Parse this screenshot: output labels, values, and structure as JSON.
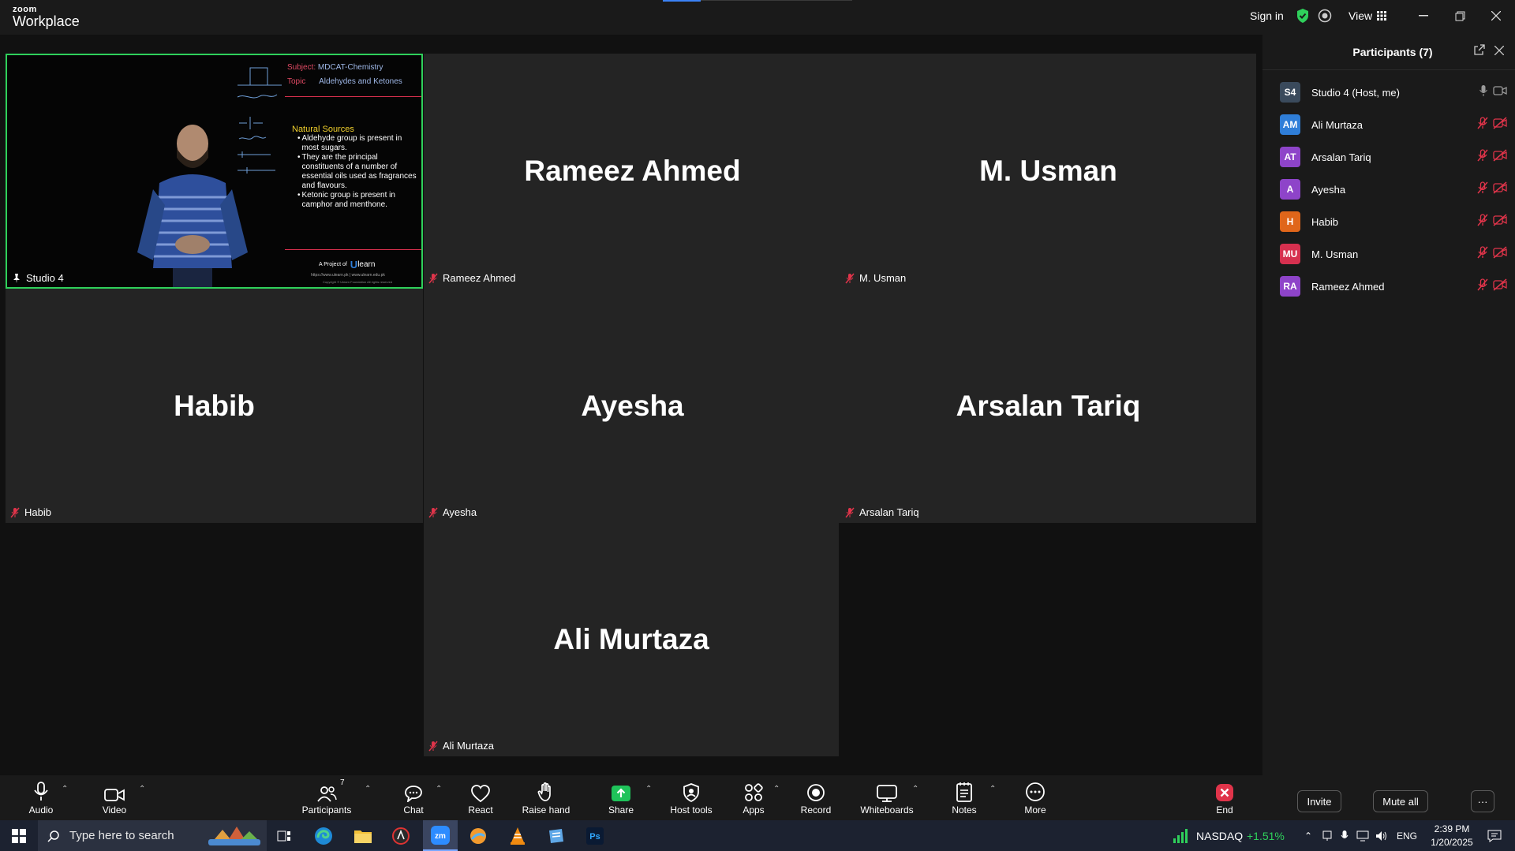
{
  "titlebar": {
    "logo_top": "zoom",
    "logo_bottom": "Workplace",
    "sign_in": "Sign in",
    "view": "View"
  },
  "tiles": [
    {
      "big": "",
      "tag": "Studio 4"
    },
    {
      "big": "Rameez Ahmed",
      "tag": "Rameez Ahmed"
    },
    {
      "big": "M. Usman",
      "tag": "M. Usman"
    },
    {
      "big": "Habib",
      "tag": "Habib"
    },
    {
      "big": "Ayesha",
      "tag": "Ayesha"
    },
    {
      "big": "Arsalan Tariq",
      "tag": "Arsalan Tariq"
    },
    {
      "big": "Ali Murtaza",
      "tag": "Ali Murtaza"
    }
  ],
  "slide": {
    "subject_label": "Subject:",
    "subject_value": "MDCAT-Chemistry",
    "topic_label": "Topic",
    "topic_value": "Aldehydes and Ketones",
    "heading": "Natural Sources",
    "bullets": [
      "Aldehyde group is present in most sugars.",
      "They are the principal constituents of a number of essential oils used as fragrances and flavours.",
      "Ketonic group is present in camphor and menthone."
    ],
    "footer_project": "A Project of",
    "footer_brand": "learn",
    "footer_line1": "https://www.ulearn.pk | www.ulearn.edu.pk",
    "footer_line2": "Copyright © Ulearn Foundation All rights reserved"
  },
  "participants": {
    "title": "Participants (7)",
    "list": [
      {
        "initials": "S4",
        "name": "Studio 4 (Host, me)",
        "color": "#3a4a5c",
        "muted": false
      },
      {
        "initials": "AM",
        "name": "Ali Murtaza",
        "color": "#2f7ed8",
        "muted": true
      },
      {
        "initials": "AT",
        "name": "Arsalan Tariq",
        "color": "#8e44c9",
        "muted": true
      },
      {
        "initials": "A",
        "name": "Ayesha",
        "color": "#8e44c9",
        "muted": true
      },
      {
        "initials": "H",
        "name": "Habib",
        "color": "#e0661a",
        "muted": true
      },
      {
        "initials": "MU",
        "name": "M. Usman",
        "color": "#d6304f",
        "muted": true
      },
      {
        "initials": "RA",
        "name": "Rameez Ahmed",
        "color": "#8e44c9",
        "muted": true
      }
    ],
    "invite": "Invite",
    "mute_all": "Mute all",
    "more": "···"
  },
  "toolbar": {
    "audio": "Audio",
    "video": "Video",
    "participants": "Participants",
    "participants_count": "7",
    "chat": "Chat",
    "react": "React",
    "raise_hand": "Raise hand",
    "share": "Share",
    "host_tools": "Host tools",
    "apps": "Apps",
    "record": "Record",
    "whiteboards": "Whiteboards",
    "notes": "Notes",
    "more": "More",
    "end": "End"
  },
  "taskbar": {
    "search_placeholder": "Type here to search",
    "ticker": "NASDAQ",
    "ticker_change": "+1.51%",
    "lang": "ENG",
    "time": "2:39 PM",
    "date": "1/20/2025"
  },
  "colors": {
    "active_border": "#2fd05b",
    "muted_red": "#e0344a",
    "tile_bg": "#242424",
    "share_green": "#1fc35a"
  }
}
